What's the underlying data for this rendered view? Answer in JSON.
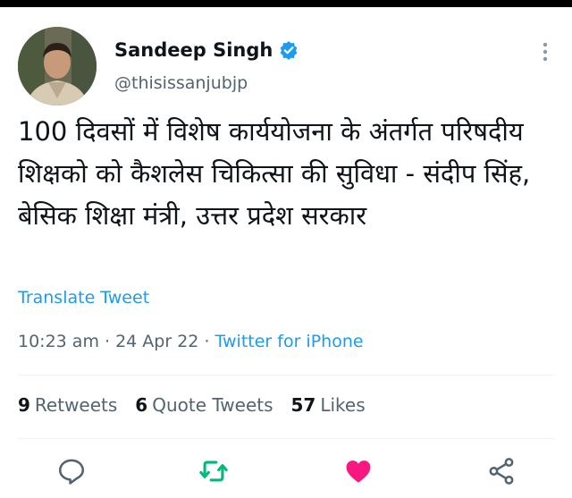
{
  "author": {
    "name": "Sandeep Singh",
    "handle": "@thisissanjubjp"
  },
  "tweet": {
    "text": "100 दिवसों में विशेष कार्ययोजना के अंतर्गत परिषदीय शिक्षको को कैशलेस चिकित्सा की सुविधा - संदीप सिंह, बेसिक शिक्षा मंत्री, उत्तर प्रदेश सरकार",
    "translate_label": "Translate Tweet",
    "time": "10:23 am",
    "date": "24 Apr 22",
    "source": "Twitter for iPhone"
  },
  "stats": {
    "retweets_count": "9",
    "retweets_label": "Retweets",
    "quotes_count": "6",
    "quotes_label": "Quote Tweets",
    "likes_count": "57",
    "likes_label": "Likes"
  },
  "icons": {
    "verified": "verified-badge-icon",
    "more": "more-vertical-icon",
    "reply": "reply-icon",
    "retweet": "retweet-icon",
    "like": "heart-filled-icon",
    "share": "share-icon"
  },
  "colors": {
    "accent": "#1d9bf0",
    "retweet": "#00ba7c",
    "like": "#f91880",
    "muted": "#536471"
  }
}
